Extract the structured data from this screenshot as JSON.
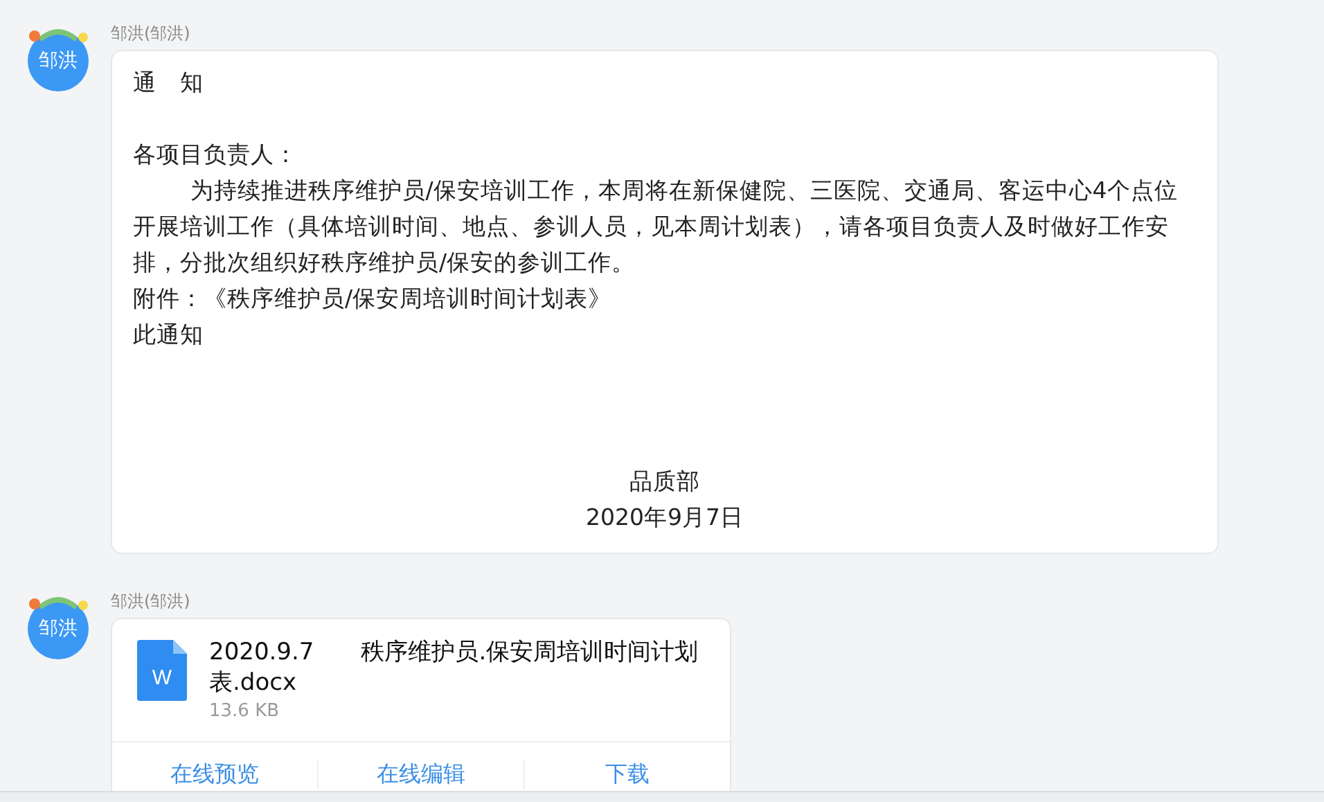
{
  "messages": [
    {
      "kind": "text",
      "avatar": "邹洪",
      "sender": "邹洪(邹洪)",
      "paragraphs": [
        {
          "kind": "title",
          "text": "通　知"
        },
        {
          "kind": "blank"
        },
        {
          "kind": "plain",
          "text": "各项目负责人："
        },
        {
          "kind": "indent",
          "text": "为持续推进秩序维护员/保安培训工作，本周将在新保健院、三医院、交通局、客运中心4个点位开展培训工作（具体培训时间、地点、参训人员，见本周计划表），请各项目负责人及时做好工作安排，分批次组织好秩序维护员/保安的参训工作。"
        },
        {
          "kind": "plain",
          "text": "附件：《秩序维护员/保安周培训时间计划表》"
        },
        {
          "kind": "plain",
          "text": "此通知"
        },
        {
          "kind": "gap"
        },
        {
          "kind": "center",
          "text": "品质部"
        },
        {
          "kind": "center",
          "text": "2020年9月7日"
        }
      ]
    },
    {
      "kind": "file",
      "avatar": "邹洪",
      "sender": "邹洪(邹洪)",
      "file": {
        "name": "2020.9.7　　秩序维护员.保安周培训时间计划表.docx",
        "size": "13.6 KB",
        "icon": "W"
      },
      "actions": [
        "在线预览",
        "在线编辑",
        "下载"
      ]
    }
  ]
}
